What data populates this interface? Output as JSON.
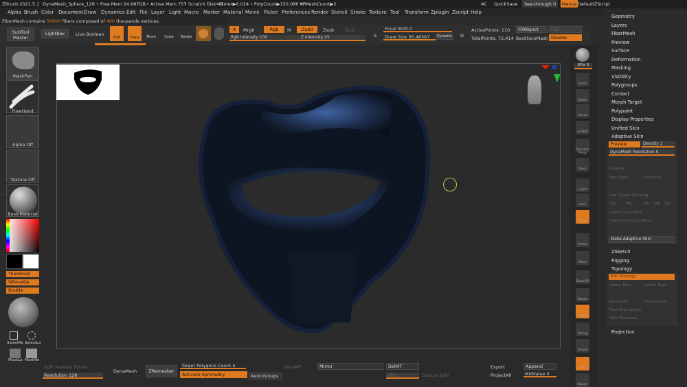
{
  "title_bar": {
    "app": "ZBrush 2021.5.1",
    "document": "DynaMesh_Sphere_128",
    "free_mem": "• Free Mem 24.687GB",
    "active_mem": "• Active Mem 757",
    "scratch_disk": "• Scratch Disk 49",
    "timer": "• Timer▶0.024",
    "polycount": "• PolyCount▶150.086 KP",
    "meshcount": "• MeshCount▶2",
    "ac": "AC",
    "quicksave": "QuickSave",
    "see_through": "See-through  0",
    "menus": "Menus",
    "default_script": "DefaultZScript"
  },
  "menu_bar": [
    "Alpha",
    "Brush",
    "Color",
    "Document",
    "Draw",
    "Dynamics",
    "Edit",
    "File",
    "Layer",
    "Light",
    "Macro",
    "Marker",
    "Material",
    "Movie",
    "Picker",
    "Preferences",
    "Render",
    "Stencil",
    "Stroke",
    "Texture",
    "Tool",
    "Transform",
    "Zplugin",
    "Zscript",
    "Help"
  ],
  "notice": {
    "pre": "FiberMesh contains ",
    "fibers": "50000",
    "mid": " fibers composed of ",
    "verts": "400",
    "post": " thousands vertices."
  },
  "toolbar": {
    "subtool_master_1": "SubTool",
    "subtool_master_2": "Master",
    "lightbox": "LightBox",
    "live_boolean": "Live Boolean",
    "edit": "Edit",
    "draw": "Draw",
    "move": "Move",
    "scale": "Scale",
    "rotate": "Rotate",
    "a": "A",
    "mrgb": "Mrgb",
    "rgb": "Rgb",
    "m": "M",
    "zadd": "Zadd",
    "zsub": "Zsub",
    "zcut": "Zcut",
    "rgb_intensity": "Rgb Intensity 100",
    "z_intensity": "Z Intensity 25",
    "s": "S",
    "focal_shift": "Focal Shift 0",
    "draw_size": "Draw Size 35.48367",
    "dynamic": "Dynamic",
    "d": "D",
    "active_points": "ActivePoints: 110",
    "total_points": "TotalPoints: 72,414",
    "fill_object": "FillObject",
    "flat": "Flat",
    "backface_mask": "BackfaceMask",
    "double": "Double"
  },
  "left_shelf": {
    "maskpen": "MaskPen",
    "freehand": "FreeHand",
    "alpha_off": "Alpha Off",
    "texture_off": "Texture Off",
    "material": "BasicMaterial",
    "thumbnail": "Thumbnail",
    "silhouette": "Silhouette",
    "double": "Double",
    "select_rect": "SelectRe",
    "select_lasso": "SelectLa",
    "mask_lasso": "MaskLa",
    "mask_rect": "MaskRe"
  },
  "right_shelf": [
    "BPR",
    "SPix 3",
    "Scroll",
    "Zoom",
    "Actual",
    "AAHalf",
    "Dynamic Persp",
    "Floor",
    "L.Sym",
    "Lock",
    "Qxyz",
    "Frame",
    "Move",
    "Zoom3D",
    "Rotate",
    "PolyF",
    "Transp",
    "Ghost",
    "Solo",
    "Xpose"
  ],
  "right_panel": {
    "items_top": [
      "Geometry",
      "Layers",
      "FiberMesh",
      "Preview",
      "Surface",
      "Deformation",
      "Masking",
      "Visibility",
      "Polygroups",
      "Contact",
      "Morph Target",
      "Polypaint",
      "Display Properties",
      "Unified Skin",
      "Adaptive Skin"
    ],
    "adaptive": {
      "preview": "Preview",
      "density": "Density 1",
      "dynamesh_res": "DynaMesh Resolution 0",
      "g_radial": "G.Radial",
      "max_twist": "Max Twist",
      "proximity": "Proximity",
      "use_classic": "Use Classic Skinning",
      "ires": "ires",
      "mbr": "Mbr",
      "mc": "Mc",
      "mp": "Mp",
      "pd": "Pd",
      "insert_local": "Insert Local Mesh",
      "insert_connector": "Insert Connector Mesh",
      "make_adaptive": "Make Adaptive Skin"
    },
    "items_mid": [
      "ZSketch",
      "Rigging",
      "Topology"
    ],
    "topology": {
      "edit_topology": "Edit Topology",
      "select_topo": "Select Topo",
      "delete_topo": "Delete Topo",
      "pre_subdiv": "PreSubdiv",
      "topo_smooth": "TopoSmooth",
      "max_strip": "Max Strip Length",
      "skin_thickness": "Skin Thickness"
    },
    "items_bottom": [
      "Projection"
    ]
  },
  "bottom_bar": {
    "split_masked": "Split Masked Points",
    "resolution": "Resolution 128",
    "dynamesh": "DynaMesh",
    "zremesher": "ZRemesher",
    "target_polygons": "Target Polygons Count 5",
    "activate_symmetry": "Activate Symmetry",
    "auto_groups": "Auto Groups",
    "slice_mt": "SliceMT",
    "mirror": "Mirror",
    "del_mt": "DelMT",
    "slider_label": "SDiv",
    "groups_split": "Groups Split",
    "export": "Export",
    "append": "Append",
    "project_all": "ProjectAll",
    "midvalue": "MidValue 0"
  },
  "colors": {
    "accent": "#e07a1f",
    "hair": "#3f63a0"
  }
}
